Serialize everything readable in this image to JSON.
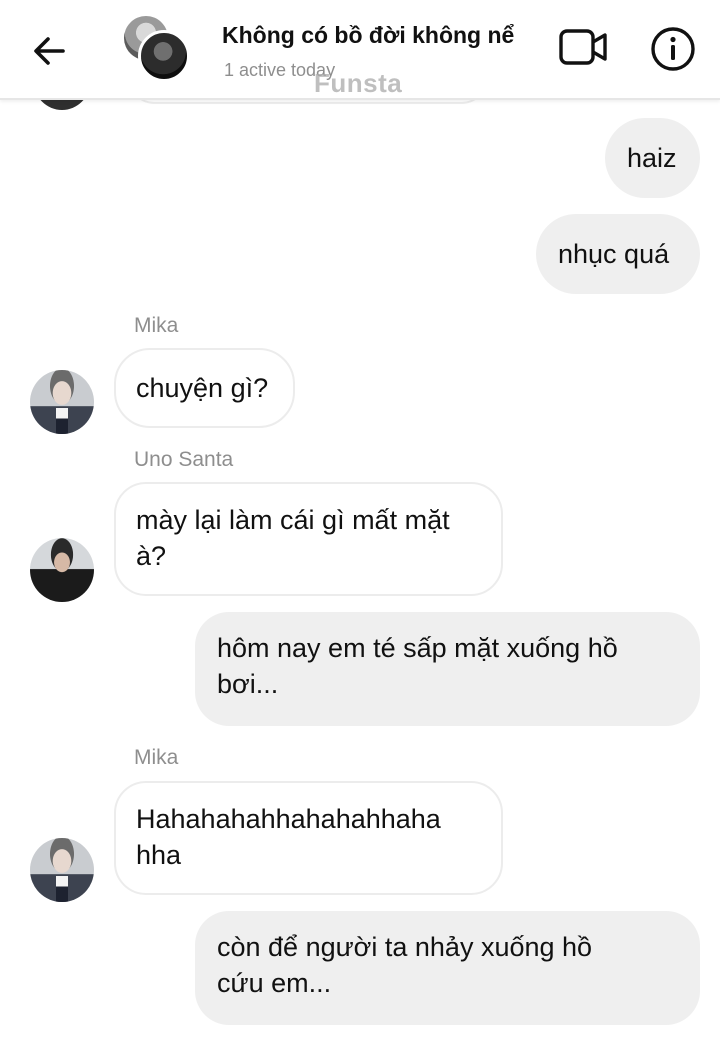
{
  "header": {
    "title": "Không có bồ đời không nể",
    "status": "1 active today",
    "watermark": "Funsta"
  },
  "icons": {
    "back": "arrow-left-icon",
    "video": "video-camera-icon",
    "info": "info-icon"
  },
  "messages": [
    {
      "direction": "outgoing",
      "text": "haiz"
    },
    {
      "direction": "outgoing",
      "text": "nhục quá"
    },
    {
      "direction": "incoming",
      "sender": "Mika",
      "text": "chuyện gì?"
    },
    {
      "direction": "incoming",
      "sender": "Uno Santa",
      "line1": "mày lại làm cái gì mất mặt",
      "line2": "à?"
    },
    {
      "direction": "outgoing",
      "line1": "hôm nay em té sấp mặt xuống hồ",
      "line2": "bơi..."
    },
    {
      "direction": "incoming",
      "sender": "Mika",
      "line1": "Hahahahahhahahahhaha",
      "line2": "hha"
    },
    {
      "direction": "outgoing",
      "line1": "còn để người ta nhảy xuống hồ",
      "line2": "cứu em..."
    }
  ]
}
